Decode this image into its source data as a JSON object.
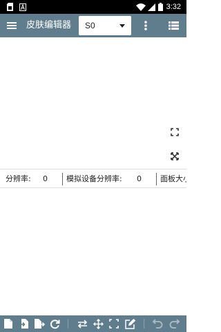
{
  "status_bar": {
    "time": "3:32",
    "sim_icon": "sim-card-icon",
    "notification_icon": "letter-a-icon"
  },
  "app_bar": {
    "title": "皮肤编辑器",
    "skin_selector": {
      "value": "S0"
    },
    "icons": [
      "hamburger-menu-icon",
      "more-vert-icon",
      "view-list-icon"
    ]
  },
  "canvas_controls": [
    "fullscreen-icon",
    "fit-screen-icon"
  ],
  "info_bar": {
    "resolution_label": "分辨率:",
    "resolution_value": "0",
    "sim_resolution_label": "模拟设备分辨率:",
    "sim_resolution_value": "0",
    "panel_size_label": "面板大小"
  },
  "bottom_toolbar": {
    "tools": [
      "new-file-icon",
      "import-file-icon",
      "export-file-icon",
      "refresh-icon",
      "swap-horizontal-icon",
      "move-icon",
      "select-area-icon",
      "edit-icon",
      "undo-icon",
      "redo-icon"
    ]
  },
  "colors": {
    "toolbar": "#5f7d8c",
    "status_bar": "#000000",
    "background": "#ffffff"
  }
}
